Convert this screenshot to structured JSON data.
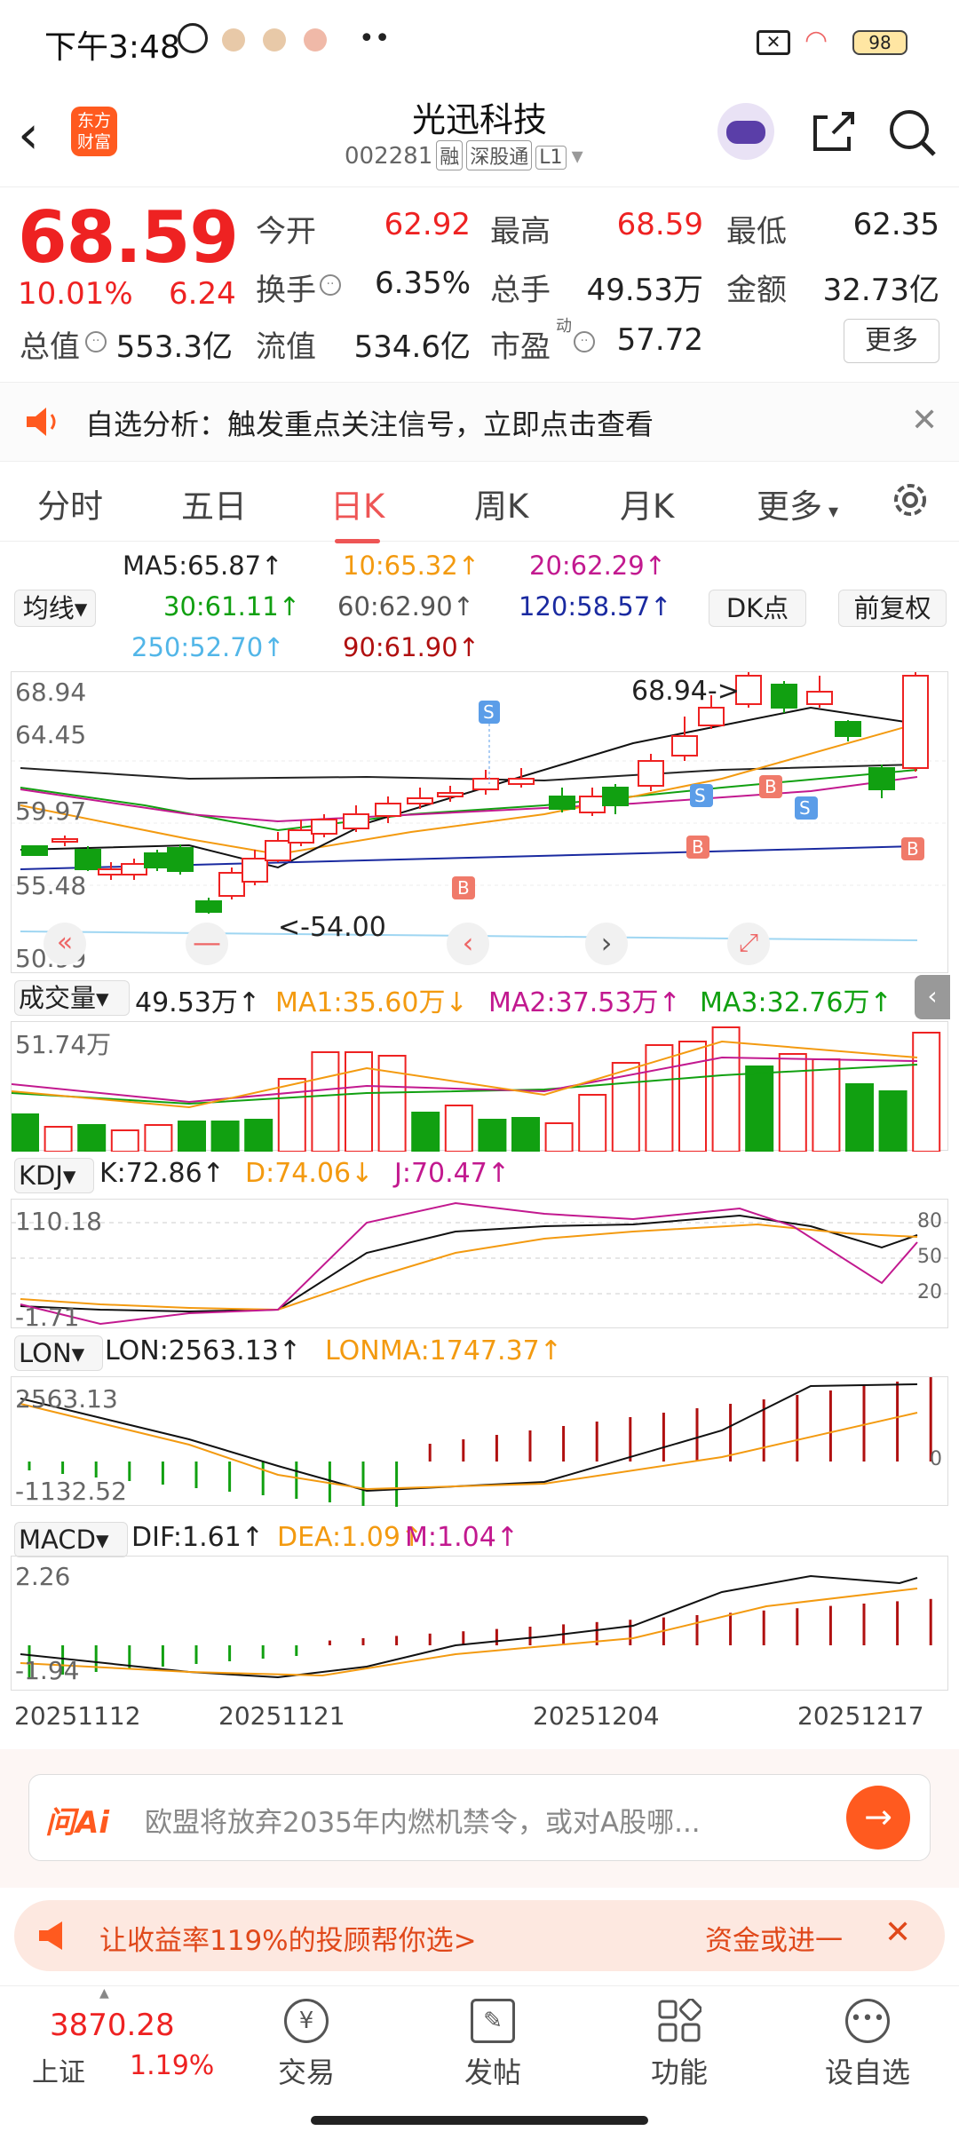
{
  "status": {
    "time": "下午3:48",
    "battery": "98"
  },
  "header": {
    "title": "光迅科技",
    "code": "002281",
    "tags": [
      "融",
      "深股通",
      "L1"
    ],
    "logo_line1": "东方",
    "logo_line2": "财富"
  },
  "quote": {
    "price": "68.59",
    "pct": "10.01%",
    "change": "6.24",
    "open_label": "今开",
    "open": "62.92",
    "high_label": "最高",
    "high": "68.59",
    "low_label": "最低",
    "low": "62.35",
    "turn_label": "换手",
    "turn": "6.35%",
    "vol_label": "总手",
    "vol": "49.53万",
    "amt_label": "金额",
    "amt": "32.73亿",
    "mcap_label": "总值",
    "mcap": "553.3亿",
    "float_label": "流值",
    "float": "534.6亿",
    "pe_label": "市盈",
    "pe_sup": "动",
    "pe": "57.72",
    "more": "更多"
  },
  "notice": {
    "text": "自选分析：触发重点关注信号，立即点击查看"
  },
  "tabs": [
    "分时",
    "五日",
    "日K",
    "周K",
    "月K",
    "更多"
  ],
  "ma": {
    "ma5": "MA5:65.87",
    "ma10": "10:65.32",
    "ma20": "20:62.29",
    "ma30": "30:61.11",
    "ma60": "60:62.90",
    "ma120": "120:58.57",
    "ma250": "250:52.70",
    "ma90": "90:61.90",
    "avg_btn": "均线",
    "dk_btn": "DK点",
    "fq_btn": "前复权"
  },
  "kline": {
    "y_labels": [
      "68.94",
      "64.45",
      "59.97",
      "55.48",
      "50.99"
    ],
    "high_note": "68.94->",
    "low_note": "<-54.00"
  },
  "volume": {
    "label": "成交量",
    "value": "49.53万",
    "ma1": "MA1:35.60万",
    "ma2": "MA2:37.53万",
    "ma3": "MA3:32.76万",
    "max": "51.74万"
  },
  "kdj": {
    "label": "KDJ",
    "k": "K:72.86",
    "d": "D:74.06",
    "j": "J:70.47",
    "top": "110.18",
    "bottom": "-1.71",
    "lv80": "80",
    "lv50": "50",
    "lv20": "20"
  },
  "lon": {
    "label": "LON",
    "lon": "LON:2563.13",
    "lonma": "LONMA:1747.37",
    "top": "2563.13",
    "bottom": "-1132.52",
    "zero": "0"
  },
  "macd": {
    "label": "MACD",
    "dif": "DIF:1.61",
    "dea": "DEA:1.09",
    "m": "M:1.04",
    "top": "2.26",
    "bottom": "-1.94"
  },
  "dates": [
    "20251112",
    "20251121",
    "20251204",
    "20251217"
  ],
  "ask": {
    "logo": "问Ai",
    "text": "欧盟将放弃2035年内燃机禁令，或对A股哪..."
  },
  "promo": {
    "text": "让收益率119%的投顾帮你选>",
    "right": "资金或进一"
  },
  "nav": {
    "index_value": "3870.28",
    "index_name": "上证",
    "index_pct": "1.19%",
    "items": [
      "交易",
      "发帖",
      "功能",
      "设自选"
    ]
  },
  "colors": {
    "up": "#e22222",
    "down": "#11a011",
    "accent": "#ff5a1f"
  }
}
